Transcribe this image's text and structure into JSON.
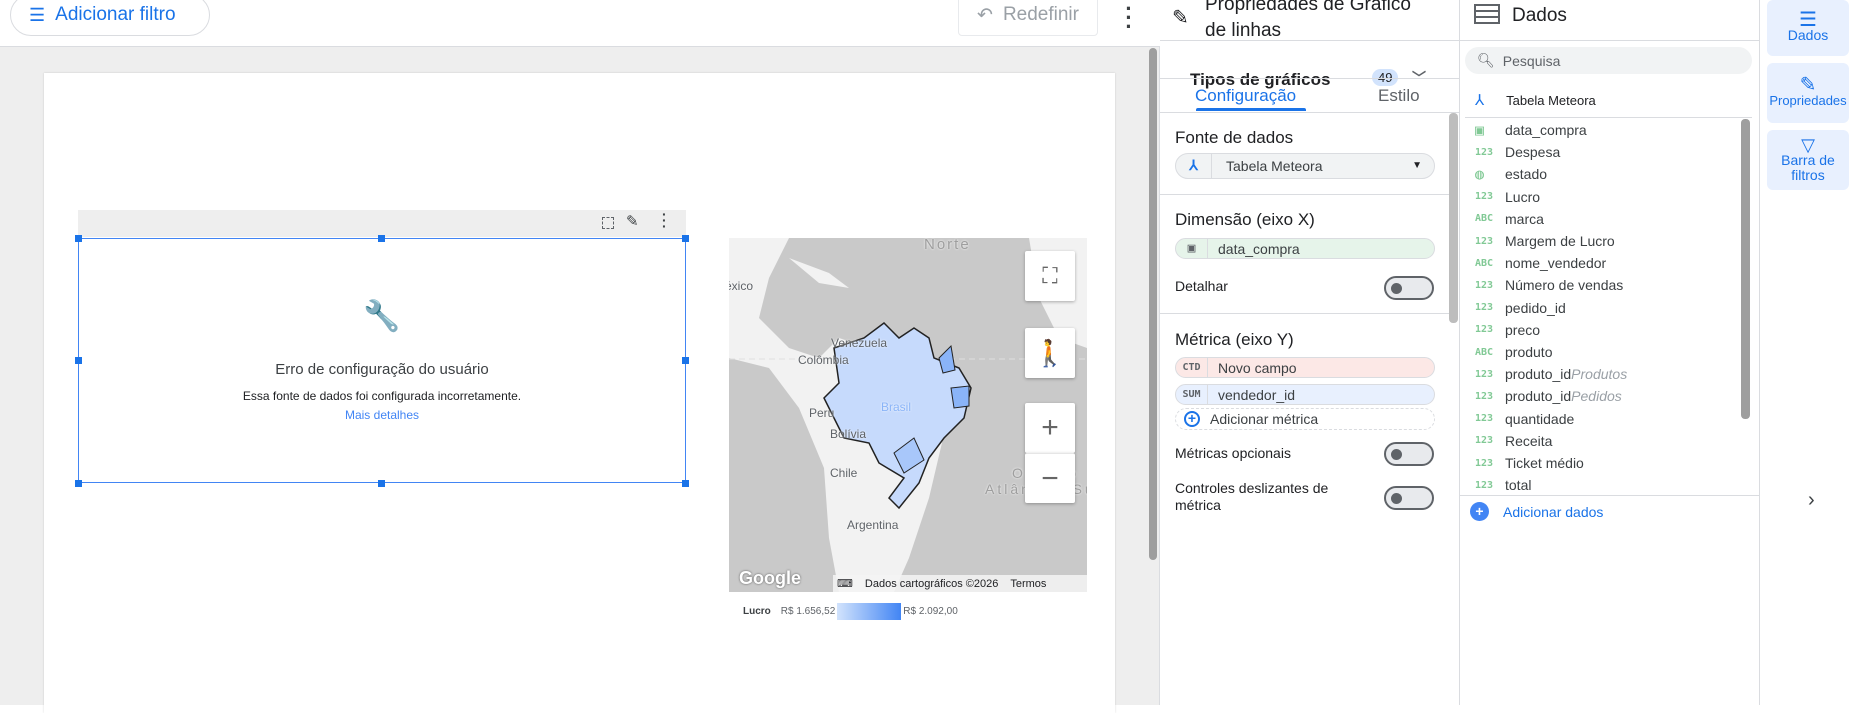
{
  "toolbar": {
    "add_filter": "Adicionar filtro",
    "reset": "Redefinir"
  },
  "error_chart": {
    "title": "Erro de configuração do usuário",
    "message": "Essa fonte de dados foi configurada incorretamente.",
    "link": "Mais detalhes"
  },
  "map": {
    "labels": {
      "north": "Norte",
      "venezuela": "Venezuela",
      "colombia": "Colômbia",
      "peru": "Peru",
      "brasil": "Brasil",
      "bolivia": "Bolívia",
      "chile": "Chile",
      "argentina": "Argentina",
      "ocean1": "Oceano",
      "ocean2": "Atlântico Sul",
      "mexico": "México"
    },
    "attribution": "Dados cartográficos ©2026",
    "terms": "Termos",
    "google": "Google"
  },
  "legend": {
    "metric": "Lucro",
    "min": "R$ 1.656,52",
    "max": "R$ 2.092,00",
    "min_color": "#d2e3fc",
    "max_color": "#4285f4"
  },
  "props": {
    "title_line1": "Propriedades de Gráfico",
    "title_line2": "de linhas",
    "chart_types": "Tipos de gráficos",
    "chart_types_count": "49",
    "tabs": [
      "Configuração",
      "Estilo"
    ],
    "data_source_title": "Fonte de dados",
    "data_source": "Tabela Meteora",
    "dimension_title": "Dimensão (eixo X)",
    "dimension": "data_compra",
    "drilldown": "Detalhar",
    "metric_title": "Métrica (eixo Y)",
    "metrics": [
      {
        "agg": "CTD",
        "name": "Novo campo",
        "color": "#fce8e6"
      },
      {
        "agg": "SUM",
        "name": "vendedor_id",
        "color": "#e8f0fe"
      }
    ],
    "add_metric": "Adicionar métrica",
    "optional_metrics": "Métricas opcionais",
    "slider_controls": "Controles deslizantes de métrica"
  },
  "data": {
    "title": "Dados",
    "search_placeholder": "Pesquisa",
    "source": "Tabela Meteora",
    "fields": [
      {
        "type": "date",
        "name": "data_compra"
      },
      {
        "type": "123",
        "name": "Despesa"
      },
      {
        "type": "geo",
        "name": "estado"
      },
      {
        "type": "123",
        "name": "Lucro"
      },
      {
        "type": "ABC",
        "name": "marca"
      },
      {
        "type": "123",
        "name": "Margem de Lucro"
      },
      {
        "type": "ABC",
        "name": "nome_vendedor"
      },
      {
        "type": "123",
        "name": "Número de vendas"
      },
      {
        "type": "123",
        "name": "pedido_id"
      },
      {
        "type": "123",
        "name": "preco"
      },
      {
        "type": "ABC",
        "name": "produto"
      },
      {
        "type": "123",
        "name": "produto_id",
        "suffix": "Produtos"
      },
      {
        "type": "123",
        "name": "produto_id",
        "suffix": "Pedidos"
      },
      {
        "type": "123",
        "name": "quantidade"
      },
      {
        "type": "123",
        "name": "Receita"
      },
      {
        "type": "123",
        "name": "Ticket médio"
      },
      {
        "type": "123",
        "name": "total"
      }
    ],
    "add_data": "Adicionar dados"
  },
  "rail": {
    "data": "Dados",
    "properties": "Propriedades",
    "filter_bar": "Barra de filtros"
  }
}
